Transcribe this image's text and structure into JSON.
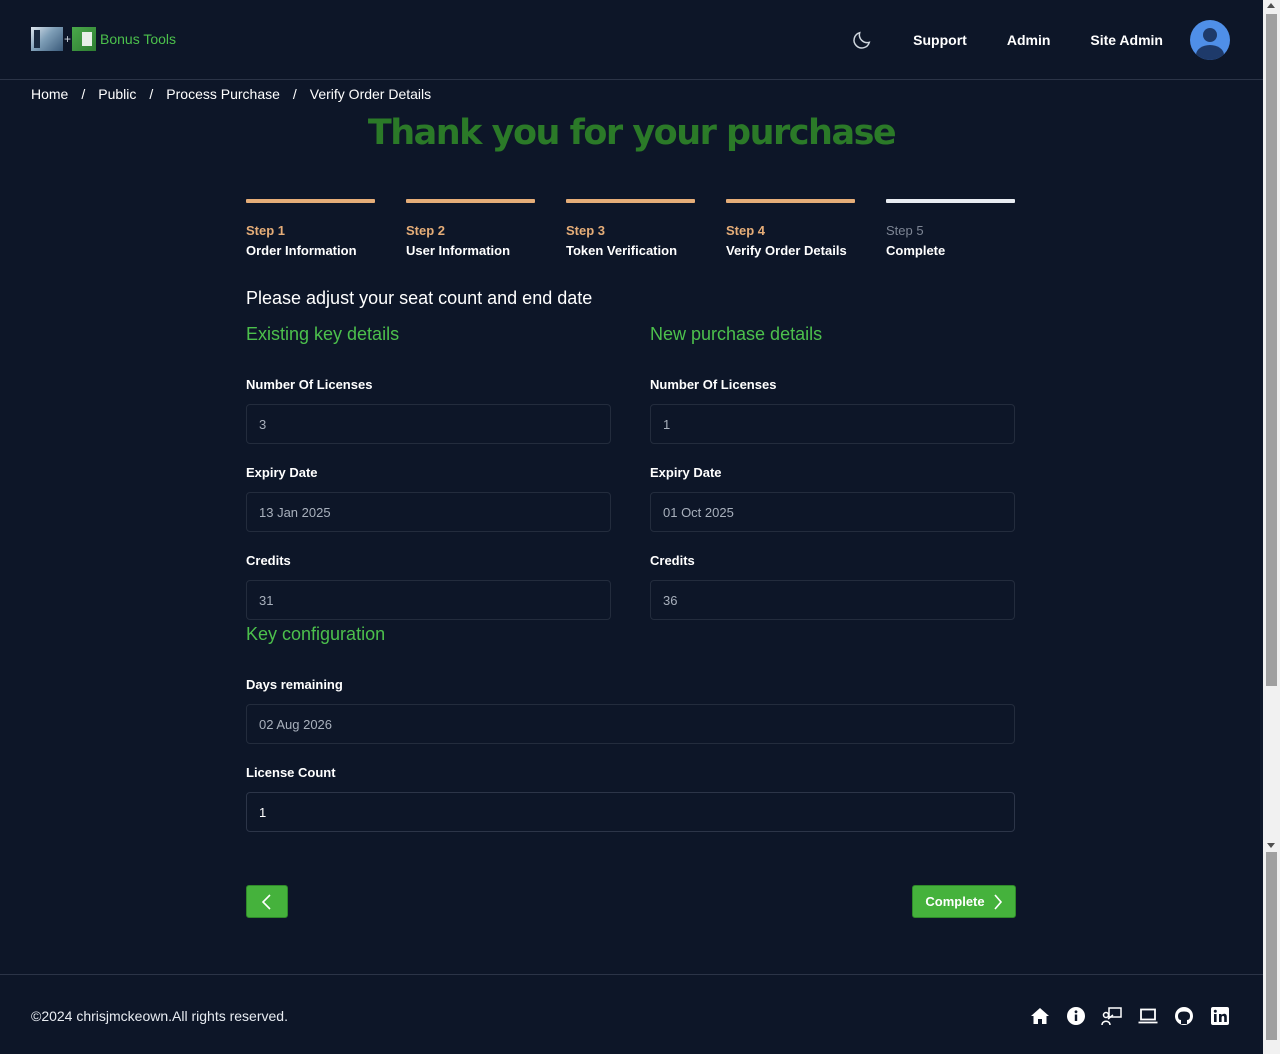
{
  "header": {
    "logo_text": "Bonus Tools",
    "logo_plus": "+",
    "nav": [
      "Support",
      "Admin",
      "Site Admin"
    ]
  },
  "breadcrumb": [
    "Home",
    "Public",
    "Process Purchase",
    "Verify Order Details"
  ],
  "breadcrumb_separator": "/",
  "title": "Thank you for your purchase",
  "steps": [
    {
      "num": "Step 1",
      "name": "Order Information",
      "state": "done"
    },
    {
      "num": "Step 2",
      "name": "User Information",
      "state": "done"
    },
    {
      "num": "Step 3",
      "name": "Token Verification",
      "state": "done"
    },
    {
      "num": "Step 4",
      "name": "Verify Order Details",
      "state": "done"
    },
    {
      "num": "Step 5",
      "name": "Complete",
      "state": "current"
    }
  ],
  "subheading": "Please adjust your seat count and end date",
  "existing": {
    "title": "Existing key details",
    "licenses_label": "Number Of Licenses",
    "licenses_value": "3",
    "expiry_label": "Expiry Date",
    "expiry_value": "13 Jan 2025",
    "credits_label": "Credits",
    "credits_value": "31"
  },
  "new_purchase": {
    "title": "New purchase details",
    "licenses_label": "Number Of Licenses",
    "licenses_value": "1",
    "expiry_label": "Expiry Date",
    "expiry_value": "01 Oct 2025",
    "credits_label": "Credits",
    "credits_value": "36"
  },
  "key_config": {
    "title": "Key configuration",
    "days_label": "Days remaining",
    "days_value": "02 Aug 2026",
    "count_label": "License Count",
    "count_value": "1"
  },
  "buttons": {
    "complete_label": "Complete"
  },
  "footer": {
    "copyright": "©2024 chrisjmckeown.All rights reserved.",
    "icons": [
      "home-icon",
      "info-icon",
      "presentation-icon",
      "laptop-icon",
      "github-icon",
      "linkedin-icon"
    ]
  },
  "colors": {
    "background": "#0d1628",
    "accent_green": "#4cc04c",
    "title_green": "#2b7a28",
    "step_done": "#e5ad78",
    "button_green": "#45b23c"
  }
}
